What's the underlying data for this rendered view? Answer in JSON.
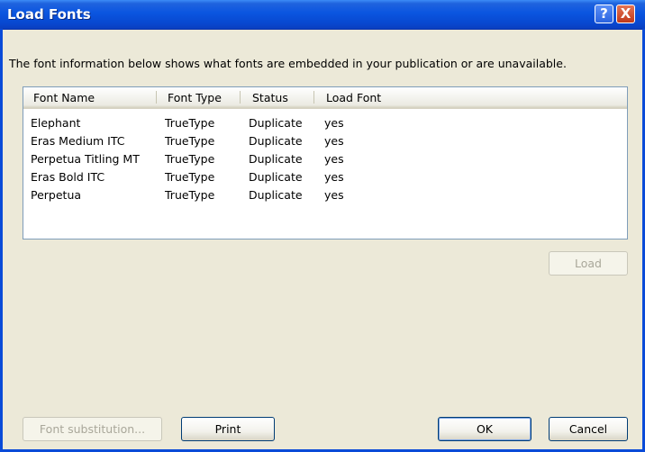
{
  "window": {
    "title": "Load Fonts",
    "help_glyph": "?",
    "close_glyph": "X"
  },
  "description": "The font information below shows what fonts are embedded in your publication or are unavailable.",
  "table": {
    "columns": [
      "Font Name",
      "Font Type",
      "Status",
      "Load Font"
    ],
    "rows": [
      [
        "Elephant",
        "TrueType",
        "Duplicate",
        "yes"
      ],
      [
        "Eras Medium ITC",
        "TrueType",
        "Duplicate",
        "yes"
      ],
      [
        "Perpetua Titling MT",
        "TrueType",
        "Duplicate",
        "yes"
      ],
      [
        "Eras Bold ITC",
        "TrueType",
        "Duplicate",
        "yes"
      ],
      [
        "Perpetua",
        "TrueType",
        "Duplicate",
        "yes"
      ]
    ]
  },
  "buttons": {
    "load": "Load",
    "font_substitution": "Font substitution...",
    "print": "Print",
    "ok": "OK",
    "cancel": "Cancel"
  }
}
